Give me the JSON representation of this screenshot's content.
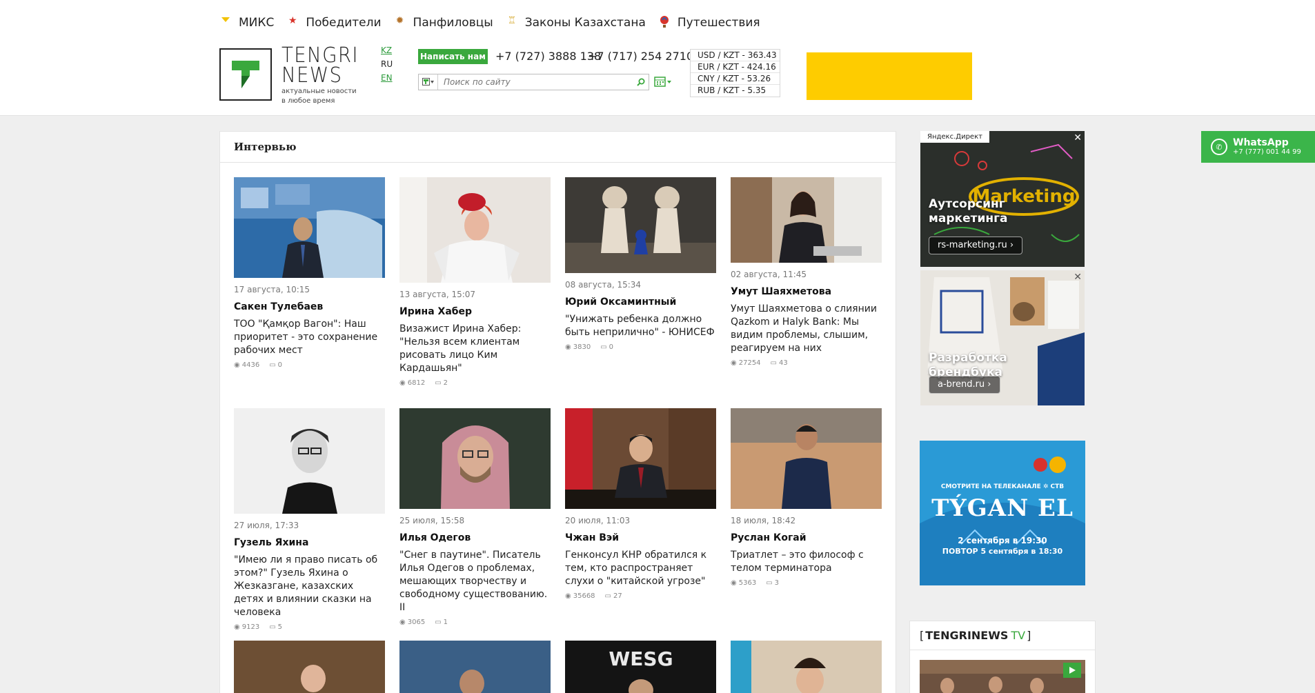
{
  "nav": [
    {
      "label": "МИКС",
      "icon": "mix-icon"
    },
    {
      "label": "Победители",
      "icon": "star-icon"
    },
    {
      "label": "Панфиловцы",
      "icon": "medal-icon"
    },
    {
      "label": "Законы Казахстана",
      "icon": "column-icon"
    },
    {
      "label": "Путешествия",
      "icon": "balloon-icon"
    }
  ],
  "brand": {
    "line1": "TENGRI",
    "line2": "NEWS",
    "tagline1": "актуальные новости",
    "tagline2": "в любое время"
  },
  "langs": [
    "KZ",
    "RU",
    "EN"
  ],
  "header": {
    "write_label": "Написать нам",
    "phone1": "+7 (727) 3888 138",
    "phone2": "+7 (717) 254 2710",
    "search_placeholder": "Поиск по сайту"
  },
  "rates": [
    "USD / KZT - 363.43",
    "EUR / KZT - 424.16",
    "CNY / KZT - 53.26",
    "RUB / KZT - 5.35"
  ],
  "section_title": "Интервью",
  "articles": [
    {
      "date": "17 августа, 10:15",
      "name": "Сакен Тулебаев",
      "lead": "ТОО \"Қамқор Вагон\": Наш приоритет - это сохранение рабочих мест",
      "views": "4436",
      "comments": "0"
    },
    {
      "date": "13 августа, 15:07",
      "name": "Ирина Хабер",
      "lead": "Визажист Ирина Хабер: \"Нельзя всем клиентам рисовать лицо Ким Кардашьян\"",
      "views": "6812",
      "comments": "2"
    },
    {
      "date": "08 августа, 15:34",
      "name": "Юрий Оксаминтный",
      "lead": "\"Унижать ребенка должно быть неприлично\" - ЮНИСЕФ",
      "views": "3830",
      "comments": "0"
    },
    {
      "date": "02 августа, 11:45",
      "name": "Умут Шаяхметова",
      "lead": "Умут Шаяхметова о слиянии Qazkom и Halyk Bank: Мы видим проблемы, слышим, реагируем на них",
      "views": "27254",
      "comments": "43"
    },
    {
      "date": "27 июля, 17:33",
      "name": "Гузель Яхина",
      "lead": "\"Имею ли я право писать об этом?\" Гузель Яхина о Жезказгане, казахских детях и влиянии сказки на человека",
      "views": "9123",
      "comments": "5"
    },
    {
      "date": "25 июля, 15:58",
      "name": "Илья Одегов",
      "lead": "\"Снег в паутине\". Писатель Илья Одегов о проблемах, мешающих творчеству и свободному существованию. II",
      "views": "3065",
      "comments": "1"
    },
    {
      "date": "20 июля, 11:03",
      "name": "Чжан Вэй",
      "lead": "Генконсул КНР обратился к тем, кто распространяет слухи о \"китайской угрозе\"",
      "views": "35668",
      "comments": "27"
    },
    {
      "date": "18 июля, 18:42",
      "name": "Руслан Когай",
      "lead": "Триатлет – это философ с телом терминатора",
      "views": "5363",
      "comments": "3"
    }
  ],
  "ads": {
    "direct_tag": "Яндекс.Директ",
    "ad1_title": "Аутсорсинг маркетинга",
    "ad1_link": "rs-marketing.ru ›",
    "ad2_title": "Разработка брендбука",
    "ad2_link": "a-brend.ru ›",
    "tv_channel_text": "СМОТРИТЕ НА ТЕЛЕКАНАЛЕ ✲ СТВ",
    "tv_show": "TÝGAN EL",
    "tv_time1": "2 сентября в 19:30",
    "tv_time2": "ПОВТОР 5 сентября в 18:30",
    "marketing_word": "Marketing"
  },
  "whatsapp": {
    "name": "WhatsApp",
    "number": "+7 (777) 001 44 99"
  },
  "tv_box": {
    "brand": "TENGRINEWS",
    "suffix": "TV"
  },
  "colors": {
    "accent": "#3aa83d",
    "banner": "#fecc00"
  }
}
